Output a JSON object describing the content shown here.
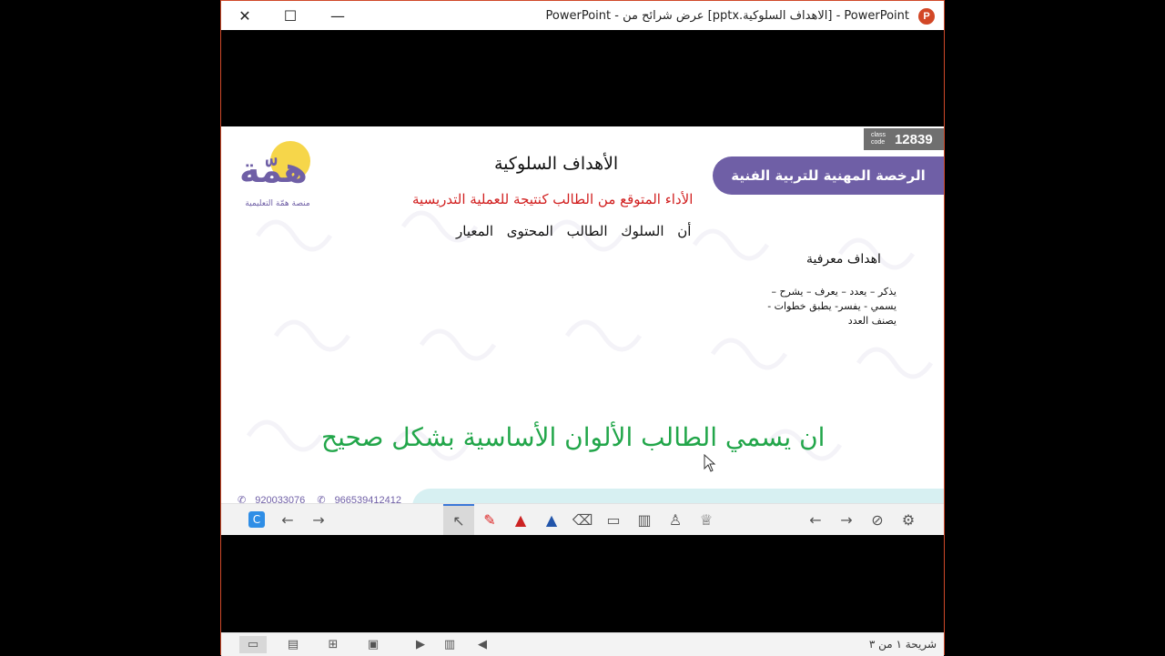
{
  "window": {
    "title": "PowerPoint - [الاهداف السلوكية.pptx] عرض شرائح من - PowerPoint",
    "app_icon_letter": "P",
    "close_glyph": "✕",
    "maximize_glyph": "☐",
    "minimize_glyph": "—"
  },
  "slide": {
    "class_code_label_1": "class",
    "class_code_label_2": "code",
    "class_code_number": "12839",
    "banner": "الرخصة المهنية للتربية الفنية",
    "logo_glyph": "همّة",
    "logo_caption": "منصة همّة التعليمية",
    "heading": "الأهداف السلوكية",
    "subtitle": "الأداء المتوقع من الطالب كنتيجة للعملية التدريسية",
    "terms": "أن   السلوك   الطالب   المحتوى   المعيار",
    "category": "اهداف معرفية",
    "verbs": "يذكر – يعدد – يعرف – يشرح – يسمي - يفسر- يطبق خطوات - يصنف العدد",
    "main_statement": "ان يسمي الطالب الألوان الأساسية بشكل صحيح",
    "contact_1": "920033076",
    "contact_2": "966539412412"
  },
  "toolbar": {
    "items": [
      {
        "icon": "settings-icon",
        "glyph": "⚙"
      },
      {
        "icon": "hide-icon",
        "glyph": "⊘"
      },
      {
        "icon": "next-icon",
        "glyph": "→"
      },
      {
        "icon": "previous-icon",
        "glyph": "←"
      },
      {
        "icon": "trophy-icon",
        "glyph": "♕"
      },
      {
        "icon": "person-icon",
        "glyph": "♙"
      },
      {
        "icon": "chart-icon",
        "glyph": "▥"
      },
      {
        "icon": "presentation-icon",
        "glyph": "▭"
      },
      {
        "icon": "eraser-icon",
        "glyph": "⌫"
      },
      {
        "icon": "highlighter-icon",
        "glyph": "▲"
      },
      {
        "icon": "pen-icon",
        "glyph": "▲"
      },
      {
        "icon": "laser-pointer-icon",
        "glyph": "✎"
      },
      {
        "icon": "arrow-pointer-icon",
        "glyph": "↖"
      }
    ],
    "right_arrow": "→",
    "left_arrow": "←",
    "app_badge": "C"
  },
  "statusbar": {
    "slide_count": "شريحة ١ من ٣",
    "icons": [
      "presenter-view-icon",
      "notes-icon",
      "slide-sorter-icon",
      "reading-view-icon",
      "play-icon",
      "book-icon",
      "back-icon"
    ]
  },
  "colors": {
    "banner": "#6f5fa6",
    "subtitle": "#d11e1e",
    "main_statement": "#22a64a",
    "accent": "#d24726"
  }
}
